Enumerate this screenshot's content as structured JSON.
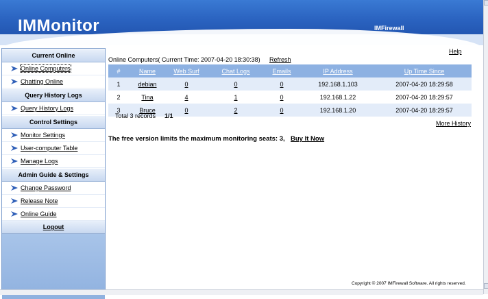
{
  "header": {
    "logo": "IMMonitor",
    "product": "IMFirewall"
  },
  "sidebar": {
    "sections": [
      {
        "title": "Current Online",
        "items": [
          "Online Computers",
          "Chatting Online"
        ]
      },
      {
        "title": "Query History Logs",
        "items": [
          "Query History Logs"
        ]
      },
      {
        "title": "Control Settings",
        "items": [
          "Monitor Settings",
          "User-computer Table",
          "Manage Logs"
        ]
      },
      {
        "title": "Admin Guide & Settings",
        "items": [
          "Change Password",
          "Release Note",
          "Online Guide"
        ]
      }
    ],
    "logout": "Logout"
  },
  "main": {
    "help": "Help",
    "title": "Online Computers( Current Time: 2007-04-20 18:30:38)",
    "refresh": "Refresh",
    "columns": [
      "#",
      "Name",
      "Web Surf",
      "Chat Logs",
      "Emails",
      "IP Address",
      "Up Time Since"
    ],
    "rows": [
      {
        "num": "1",
        "name": "debian",
        "web": "0",
        "chat": "0",
        "emails": "0",
        "ip": "192.168.1.103",
        "since": "2007-04-20 18:29:58"
      },
      {
        "num": "2",
        "name": "Tina",
        "web": "4",
        "chat": "1",
        "emails": "0",
        "ip": "192.168.1.22",
        "since": "2007-04-20 18:29:57"
      },
      {
        "num": "3",
        "name": "Bruce",
        "web": "0",
        "chat": "2",
        "emails": "0",
        "ip": "192.168.1.20",
        "since": "2007-04-20 18:29:57"
      }
    ],
    "total": "Total 3 records",
    "pages": "1/1",
    "more_history": "More History",
    "limit_text": "The free version limits the maximum monitoring seats:  3,",
    "buy": "Buy It Now",
    "copyright": "Copyright © 2007  IMFirewall Software. All rights reserved."
  },
  "colors": {
    "header": "#2a62bf",
    "table_header": "#8db1e2",
    "row_alt": "#e3ecf9",
    "sidebar": "#9fbfe6"
  }
}
